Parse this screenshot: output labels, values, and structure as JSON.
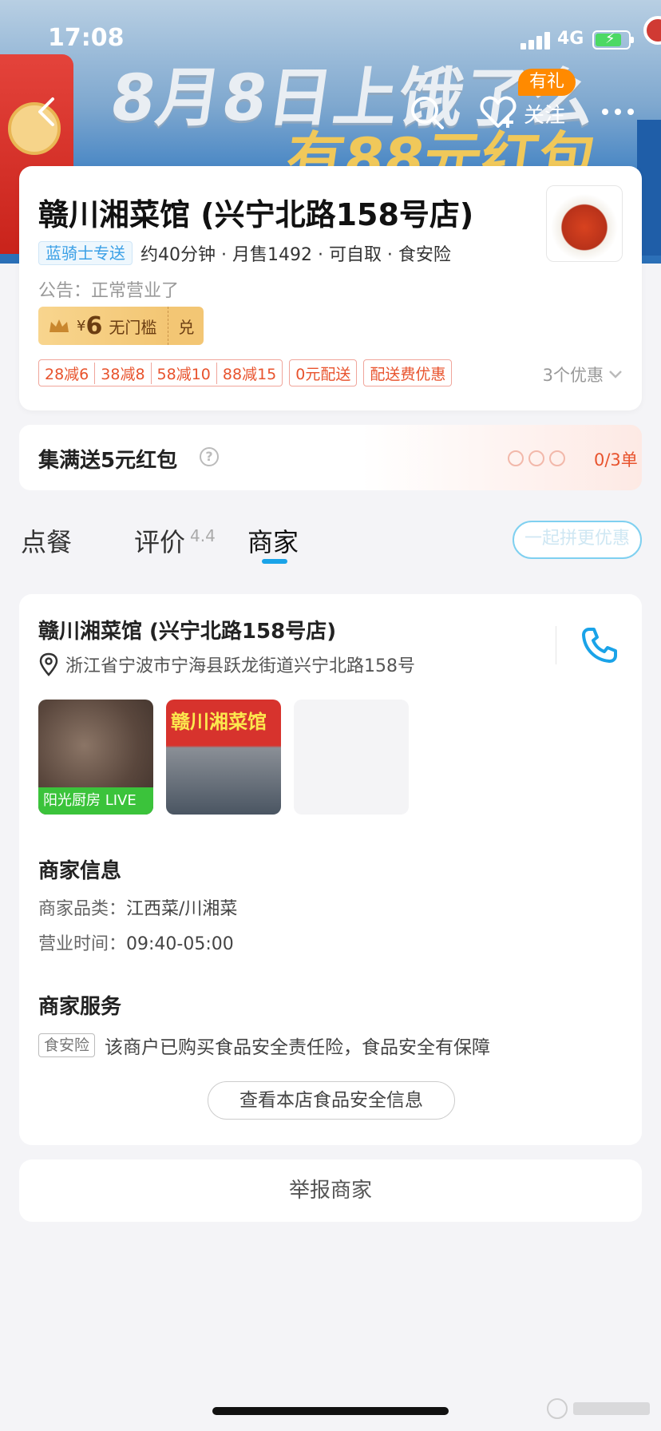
{
  "status": {
    "time": "17:08",
    "network": "4G"
  },
  "banner": {
    "line1": "8月8日上饿了么",
    "line2": "有88元红包"
  },
  "nav": {
    "gift_badge": "有礼",
    "follow_label": "关注"
  },
  "shop": {
    "name": "赣川湘菜馆 (兴宁北路158号店)",
    "delivery_tag": "蓝骑士专送",
    "meta": "约40分钟 · 月售1492 · 可自取 · 食安险",
    "notice": "公告：正常营业了",
    "coupon": {
      "currency": "¥",
      "amount": "6",
      "desc": "无门槛",
      "action": "兑"
    },
    "promos": [
      "28减6",
      "38减8",
      "58减10",
      "88减15"
    ],
    "promo_free_delivery": "0元配送",
    "promo_delivery_discount": "配送费优惠",
    "promo_more": "3个优惠"
  },
  "collect": {
    "title": "集满送5元红包",
    "count": "0/3单"
  },
  "tabs": {
    "order": "点餐",
    "review": "评价",
    "review_score": "4.4",
    "merchant": "商家",
    "group_button": "一起拼更优惠"
  },
  "merchant": {
    "name": "赣川湘菜馆 (兴宁北路158号店)",
    "address": "浙江省宁波市宁海县跃龙街道兴宁北路158号",
    "photo_live_label": "阳光厨房 LIVE",
    "photo_sign_text": "赣川湘菜馆",
    "info_title": "商家信息",
    "category_label": "商家品类：",
    "category_value": "江西菜/川湘菜",
    "hours_label": "营业时间：",
    "hours_value": "09:40-05:00",
    "service_title": "商家服务",
    "service_tag": "食安险",
    "service_text": "该商户已购买食品安全责任险，食品安全有保障",
    "food_safety_button": "查看本店食品安全信息"
  },
  "report": {
    "label": "举报商家"
  },
  "colors": {
    "accent": "#1aa3e8",
    "promo_red": "#e8532d",
    "coupon_gold": "#f3c674",
    "live_green": "#3bc33b"
  }
}
